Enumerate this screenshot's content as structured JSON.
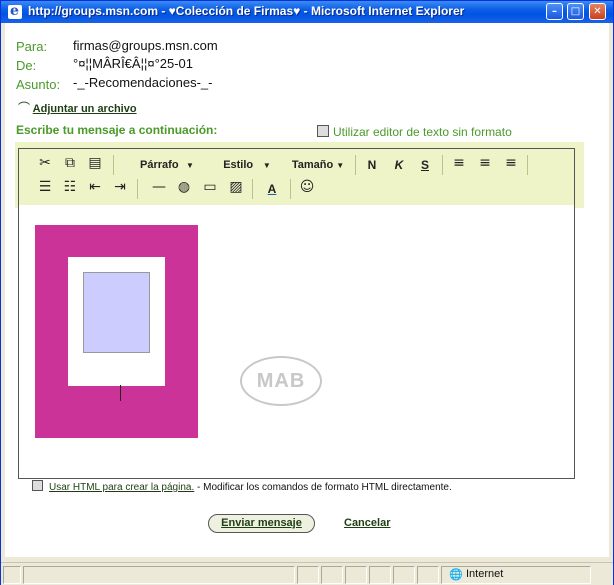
{
  "window": {
    "title": "http://groups.msn.com - ♥Colección de Firmas♥ - Microsoft Internet Explorer",
    "icon": "ie-icon",
    "controls": [
      "minimize-icon",
      "maximize-icon",
      "close-icon"
    ],
    "accent": "#0054e3"
  },
  "form": {
    "to_label": "Para:",
    "to_value": "firmas@groups.msn.com",
    "from_label": "De:",
    "from_value": "°¤¦¦MÂRÎ€Â¦¦¤°25-01",
    "subject_label": "Asunto:",
    "subject_value": "-_-Recomendaciones-_-",
    "attach_label": "Adjuntar un archivo",
    "prompt": "Escribe tu mensaje a continuación:",
    "plain_text_label": "Utilizar editor de texto sin formato",
    "label_color": "#4a9a2a"
  },
  "toolbar": {
    "paragraph_label": "Párrafo",
    "style_label": "Estilo",
    "size_label": "Tamaño",
    "bold": "N",
    "italic": "K",
    "underline": "S",
    "band_color": "#eef4c8"
  },
  "editor": {
    "signature_watermark": "MAB",
    "pink_color": "#cc3399",
    "blue_color": "#ccccff"
  },
  "html_option": {
    "link_label": "Usar HTML para crear la página.",
    "description": " - Modificar los comandos de formato HTML directamente."
  },
  "actions": {
    "send_label": "Enviar mensaje",
    "cancel_label": "Cancelar"
  },
  "statusbar": {
    "zone_label": "Internet"
  }
}
